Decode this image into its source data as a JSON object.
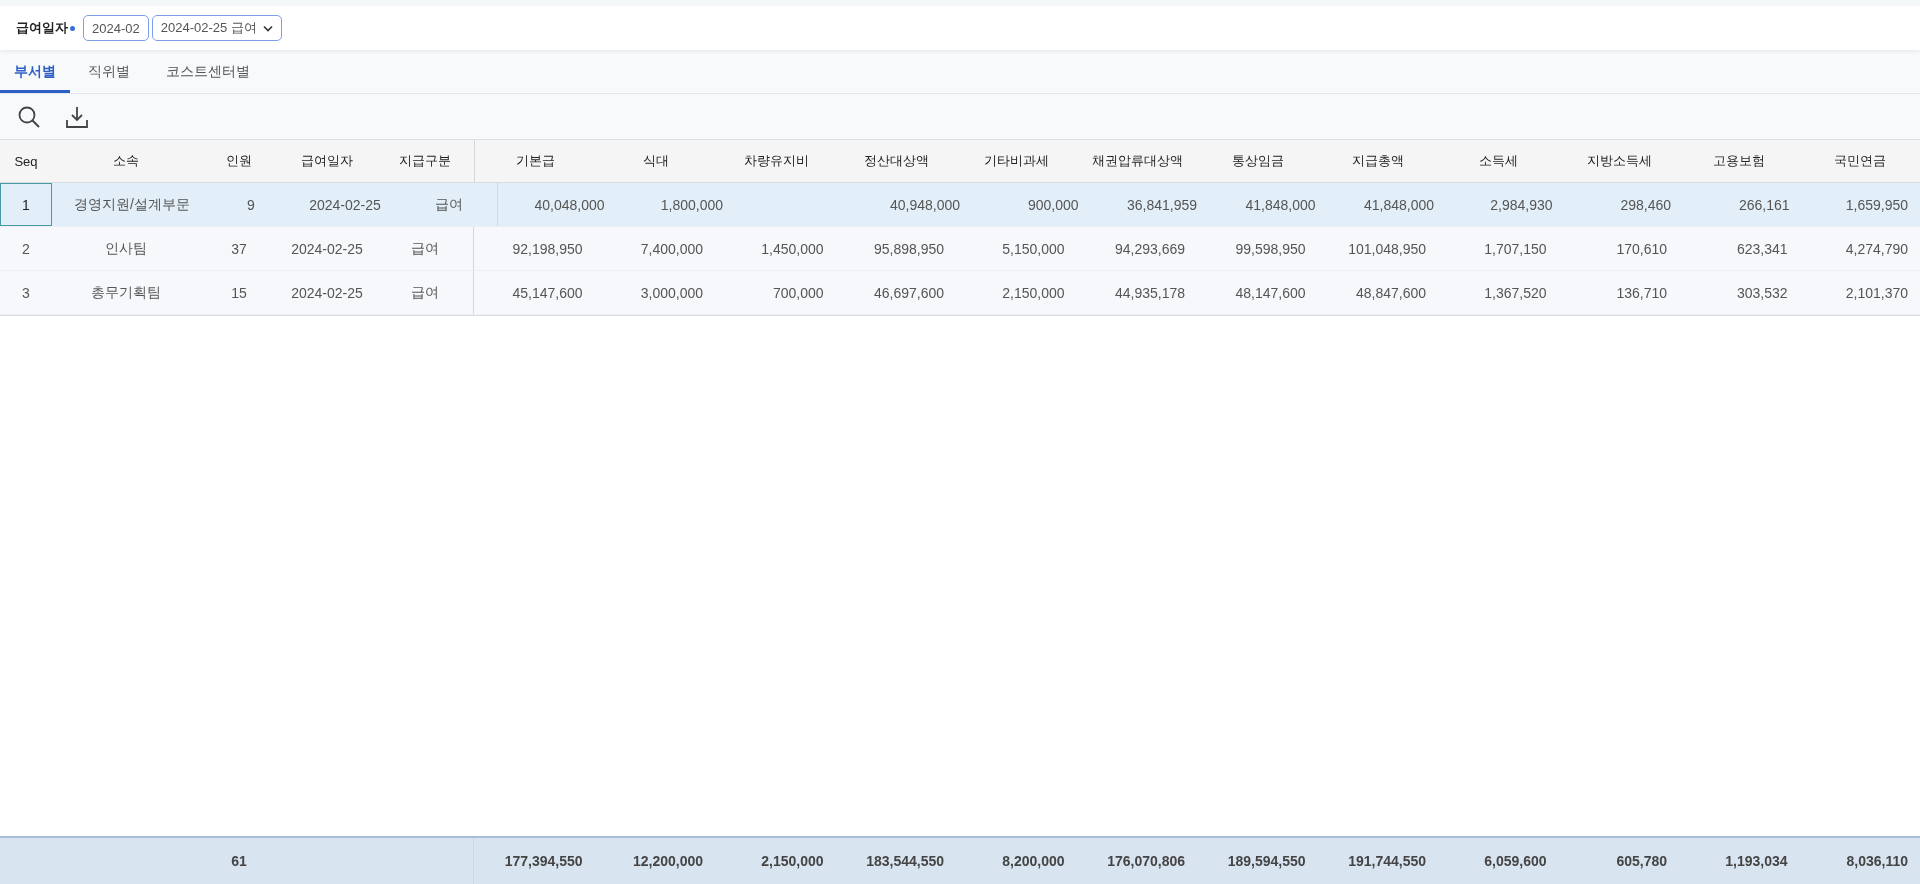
{
  "filter": {
    "label": "급여일자",
    "required": true,
    "month": "2024-02",
    "payday": "2024-02-25 급여"
  },
  "tabs": [
    {
      "label": "부서별",
      "selected": true
    },
    {
      "label": "직위별",
      "selected": false
    },
    {
      "label": "코스트센터별",
      "selected": false
    }
  ],
  "table": {
    "columns": [
      "Seq",
      "소속",
      "인원",
      "급여일자",
      "지급구분",
      "기본급",
      "식대",
      "차량유지비",
      "정산대상액",
      "기타비과세",
      "채권압류대상액",
      "통상임금",
      "지급총액",
      "소득세",
      "지방소득세",
      "고용보험",
      "국민연금"
    ],
    "rows": [
      {
        "seq": "1",
        "dept": "경영지원/설계부문",
        "count": "9",
        "date": "2024-02-25",
        "type": "급여",
        "selected": true,
        "amounts": {
          "basic_pay": "40,048,000",
          "meal": "1,800,000",
          "settlement_base": "40,948,000",
          "other_nontaxable": "900,000",
          "garnishment_base": "36,841,959",
          "ordinary_wage": "41,848,000",
          "total_pay": "41,848,000",
          "income_tax": "2,984,930",
          "local_income_tax": "298,460",
          "employment_insurance": "266,161",
          "national_pension": "1,659,950"
        }
      },
      {
        "seq": "2",
        "dept": "인사팀",
        "count": "37",
        "date": "2024-02-25",
        "type": "급여",
        "selected": false,
        "amounts": {
          "basic_pay": "92,198,950",
          "meal": "7,400,000",
          "vehicle": "1,450,000",
          "settlement_base": "95,898,950",
          "other_nontaxable": "5,150,000",
          "garnishment_base": "94,293,669",
          "ordinary_wage": "99,598,950",
          "total_pay": "101,048,950",
          "income_tax": "1,707,150",
          "local_income_tax": "170,610",
          "employment_insurance": "623,341",
          "national_pension": "4,274,790"
        }
      },
      {
        "seq": "3",
        "dept": "총무기획팀",
        "count": "15",
        "date": "2024-02-25",
        "type": "급여",
        "selected": false,
        "amounts": {
          "basic_pay": "45,147,600",
          "meal": "3,000,000",
          "vehicle": "700,000",
          "settlement_base": "46,697,600",
          "other_nontaxable": "2,150,000",
          "garnishment_base": "44,935,178",
          "ordinary_wage": "48,147,600",
          "total_pay": "48,847,600",
          "income_tax": "1,367,520",
          "local_income_tax": "136,710",
          "employment_insurance": "303,532",
          "national_pension": "2,101,370"
        }
      }
    ],
    "totals": {
      "count": "61",
      "amounts": [
        "177,394,550",
        "12,200,000",
        "2,150,000",
        "183,544,550",
        "8,200,000",
        "176,070,806",
        "189,594,550",
        "191,744,550",
        "6,059,600",
        "605,780",
        "1,193,034",
        "8,036,110"
      ]
    }
  }
}
